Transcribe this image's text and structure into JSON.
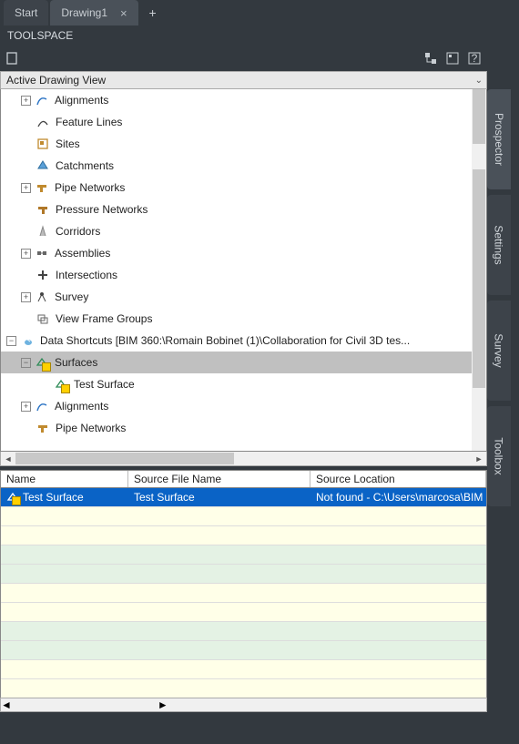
{
  "tabs": {
    "start": "Start",
    "drawing": "Drawing1"
  },
  "panel_title": "TOOLSPACE",
  "view_selector": "Active Drawing View",
  "tree": {
    "alignments": "Alignments",
    "feature_lines": "Feature Lines",
    "sites": "Sites",
    "catchments": "Catchments",
    "pipe_networks": "Pipe Networks",
    "pressure_networks": "Pressure Networks",
    "corridors": "Corridors",
    "assemblies": "Assemblies",
    "intersections": "Intersections",
    "survey": "Survey",
    "view_frame_groups": "View Frame Groups",
    "data_shortcuts": "Data Shortcuts [BIM 360:\\Romain Bobinet (1)\\Collaboration for Civil 3D tes...",
    "surfaces": "Surfaces",
    "test_surface": "Test Surface",
    "ds_alignments": "Alignments",
    "ds_pipe_networks": "Pipe Networks"
  },
  "grid": {
    "headers": {
      "name": "Name",
      "source_file": "Source File Name",
      "source_location": "Source Location"
    },
    "rows": [
      {
        "name": "Test Surface",
        "source_file": "Test Surface",
        "source_location": "Not found - C:\\Users\\marcosa\\BIM"
      }
    ]
  },
  "sidetabs": {
    "prospector": "Prospector",
    "settings": "Settings",
    "survey": "Survey",
    "toolbox": "Toolbox"
  }
}
